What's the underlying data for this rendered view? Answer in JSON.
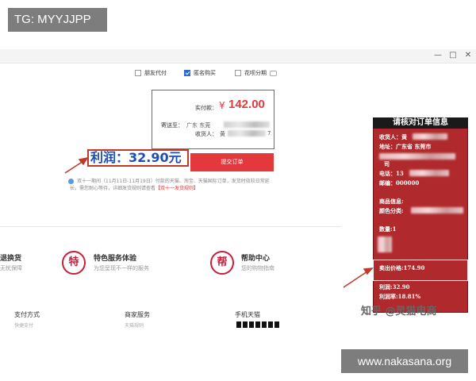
{
  "overlay_tag": "TG: MYYJJPP",
  "watermark": "www.nakasana.org",
  "window_controls": [
    "—",
    "□",
    "✕"
  ],
  "options": [
    {
      "label": "朋友代付",
      "checked": false
    },
    {
      "label": "匿名购买",
      "checked": true
    },
    {
      "label": "花呗分期",
      "checked": false
    }
  ],
  "summary": {
    "pay_label": "实付款：",
    "currency": "¥",
    "amount": "142.00",
    "ship_label": "寄送至：",
    "ship_value": "广东 东莞",
    "recv_label": "收货人：",
    "recv_value": "黄",
    "recv_tail": "7"
  },
  "submit_label": "提交订单",
  "profit_label": "利润：32.90元",
  "notice": {
    "text": "双十一期间（11月11日-11月19日）付款的天猫、淘宝、天猫国际订单，发货时效较日常延长，需您耐心等待，详细发货规则请查看",
    "link": "【双十一发货规则】"
  },
  "services": [
    {
      "icon": "",
      "title": "退换货",
      "sub": "无忧保障"
    },
    {
      "icon": "特",
      "title": "特色服务体验",
      "sub": "为您呈现不一样的服务"
    },
    {
      "icon": "帮",
      "title": "帮助中心",
      "sub": "您的购物指南"
    }
  ],
  "footer": [
    {
      "title": "支付方式",
      "sub": "快捷支付"
    },
    {
      "title": "商家服务",
      "sub": "天猫规则"
    },
    {
      "title": "手机天猫",
      "sub": ""
    }
  ],
  "panel": {
    "title": "请核对订单信息",
    "receiver": "收货人：黄",
    "address": "地址：广东省 东莞市",
    "address_tail": "司",
    "phone": "电话：13",
    "zip": "邮编：000000",
    "goods": "商品信息:",
    "color": "颜色分类:",
    "qty": "数量:1",
    "sell_price": "卖出价格:174.90",
    "profit": "利润:32.90",
    "profit_rate": "利润率:18.81%"
  },
  "zhihu_caption": "知乎 @灵猫电商",
  "colors": {
    "accent_red": "#e4393c",
    "panel_red": "#b0292d",
    "profit_blue": "#1f4fae"
  }
}
